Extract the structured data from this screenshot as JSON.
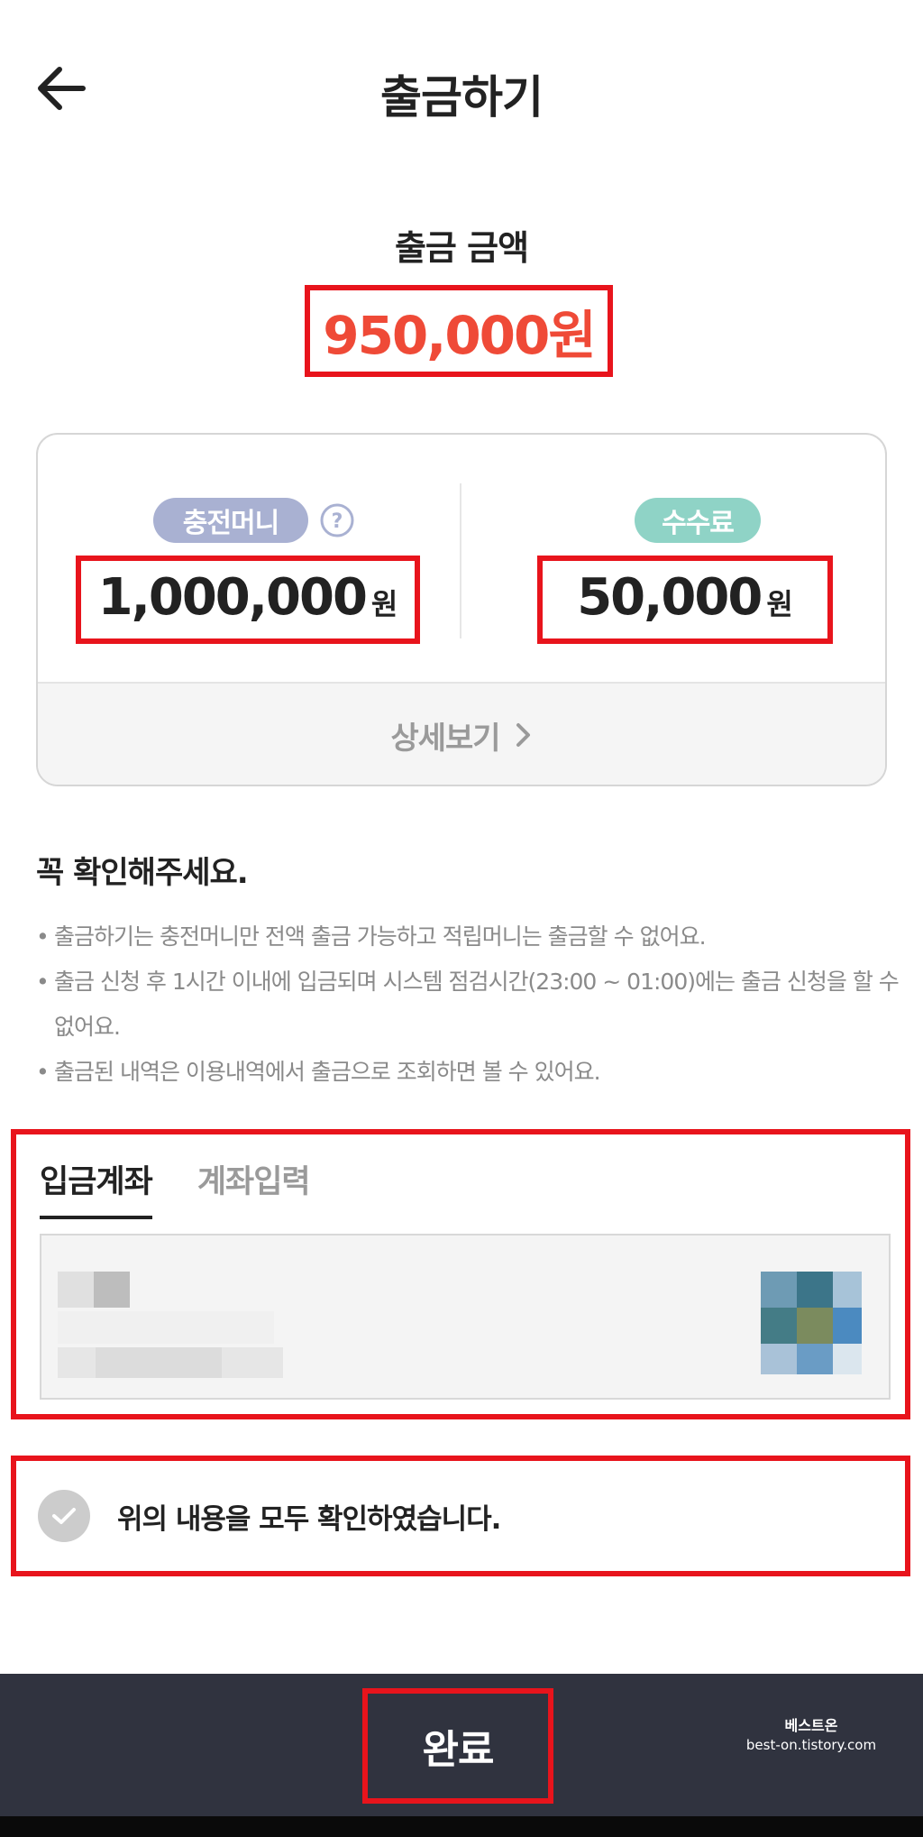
{
  "header": {
    "title": "출금하기",
    "back_icon": "arrow-left-icon"
  },
  "withdraw": {
    "label": "출금 금액",
    "amount": "950,000원"
  },
  "summary": {
    "charge_label": "충전머니",
    "charge_amount": "1,000,000",
    "charge_unit": "원",
    "fee_label": "수수료",
    "fee_amount": "50,000",
    "fee_unit": "원",
    "detail_label": "상세보기",
    "help_icon": "question-circle-icon",
    "detail_icon": "chevron-right-icon"
  },
  "notice": {
    "title": "꼭 확인해주세요.",
    "items": [
      "출금하기는 충전머니만 전액 출금 가능하고 적립머니는 출금할 수 없어요.",
      "출금 신청 후 1시간 이내에 입금되며 시스템 점검시간(23:00 ~ 01:00)에는 출금 신청을 할 수 없어요.",
      "출금된 내역은 이용내역에서 출금으로 조회하면 볼 수 있어요."
    ]
  },
  "account": {
    "tabs": [
      {
        "label": "입금계좌",
        "active": true
      },
      {
        "label": "계좌입력",
        "active": false
      }
    ]
  },
  "confirm": {
    "label": "위의 내용을 모두 확인하였습니다.",
    "icon": "check-icon"
  },
  "footer": {
    "done_label": "완료",
    "watermark_line1": "베스트온",
    "watermark_line2": "best-on.tistory.com"
  },
  "colors": {
    "accent_red": "#ef4a37",
    "highlight_border": "#e8141c",
    "charge_pill": "#a9b1d2",
    "fee_pill": "#8fd3c6",
    "bottom_bar": "#30333f"
  }
}
